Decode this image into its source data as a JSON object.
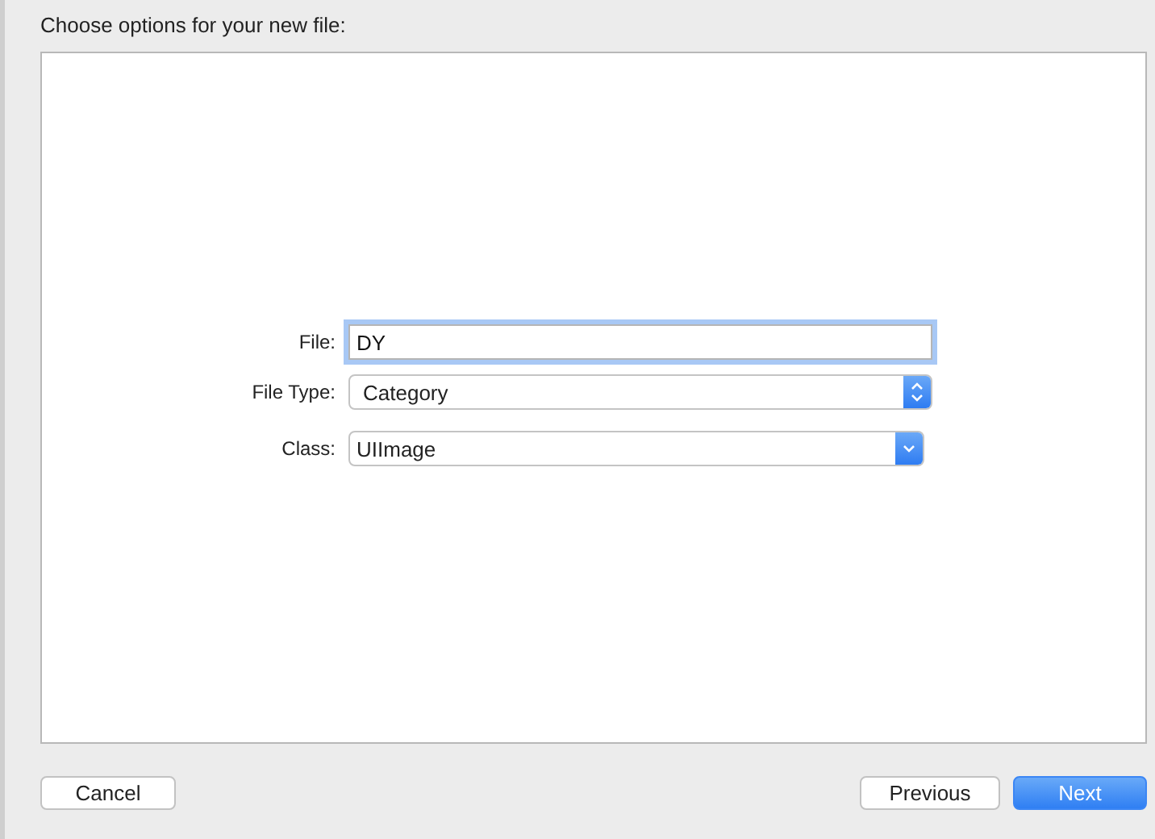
{
  "heading": "Choose options for your new file:",
  "fields": [
    {
      "label": "File:",
      "kind": "text",
      "value": "DY",
      "focused": true
    },
    {
      "label": "File Type:",
      "kind": "stepper",
      "value": "Category"
    },
    {
      "label": "Class:",
      "kind": "dropdown",
      "value": "UIImage"
    }
  ],
  "buttons": [
    {
      "label": "Cancel",
      "primary": false
    },
    {
      "label": "Previous",
      "primary": false
    },
    {
      "label": "Next",
      "primary": true
    }
  ]
}
